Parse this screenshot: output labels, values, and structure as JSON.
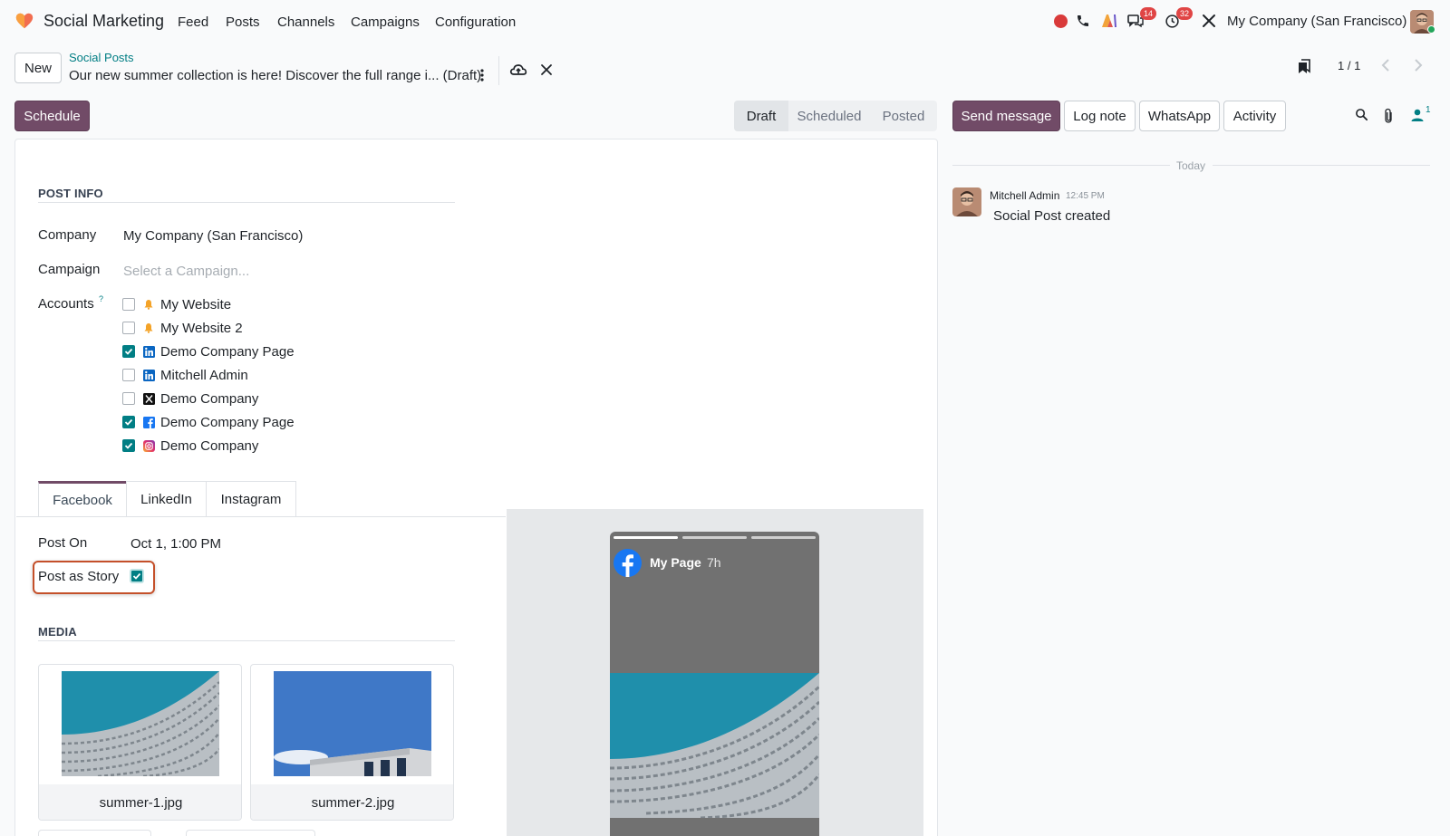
{
  "app": {
    "name": "Social Marketing",
    "menu": [
      "Feed",
      "Posts",
      "Channels",
      "Campaigns",
      "Configuration"
    ],
    "company": "My Company (San Francisco)",
    "badges": {
      "messages": "14",
      "activities": "32"
    }
  },
  "control": {
    "new_label": "New",
    "breadcrumb": "Social Posts",
    "record_title": "Our new summer collection is here! Discover the full range i... (Draft)",
    "pager": "1 / 1",
    "schedule_label": "Schedule",
    "stages": [
      "Draft",
      "Scheduled",
      "Posted"
    ],
    "active_stage": "Draft"
  },
  "chatter": {
    "buttons": [
      "Send message",
      "Log note",
      "WhatsApp",
      "Activity"
    ],
    "followers": "1",
    "today": "Today",
    "author": "Mitchell Admin",
    "time": "12:45 PM",
    "message": "Social Post created"
  },
  "form": {
    "post_info_title": "POST INFO",
    "company_label": "Company",
    "company_value": "My Company (San Francisco)",
    "campaign_label": "Campaign",
    "campaign_placeholder": "Select a Campaign...",
    "accounts_label": "Accounts",
    "help": "?",
    "accounts": [
      {
        "name": "My Website",
        "icon": "bell-icon",
        "checked": false
      },
      {
        "name": "My Website 2",
        "icon": "bell-icon",
        "checked": false
      },
      {
        "name": "Demo Company Page",
        "icon": "linkedin-icon",
        "checked": true
      },
      {
        "name": "Mitchell Admin",
        "icon": "linkedin-icon",
        "checked": false
      },
      {
        "name": "Demo Company",
        "icon": "x-icon",
        "checked": false
      },
      {
        "name": "Demo Company Page",
        "icon": "facebook-icon",
        "checked": true
      },
      {
        "name": "Demo Company",
        "icon": "instagram-icon",
        "checked": true
      }
    ],
    "tabs": [
      "Facebook",
      "LinkedIn",
      "Instagram"
    ],
    "active_tab": "Facebook",
    "post_on_label": "Post On",
    "post_on_value": "Oct 1, 1:00 PM",
    "post_as_story_label": "Post as Story",
    "post_as_story": true,
    "media_title": "MEDIA",
    "media": [
      "summer-1.jpg",
      "summer-2.jpg"
    ]
  },
  "preview": {
    "page_name": "My Page",
    "age": "7h"
  },
  "colors": {
    "primary": "#714b67",
    "teal": "#017e84",
    "highlight": "#c4502a",
    "facebook": "#1877f2",
    "linkedin": "#0a66c2"
  }
}
